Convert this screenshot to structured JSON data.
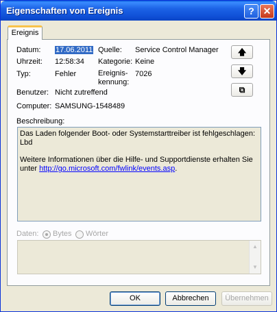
{
  "window": {
    "title": "Eigenschaften von Ereignis",
    "help_glyph": "?",
    "close_glyph": "✕"
  },
  "tab": {
    "label": "Ereignis"
  },
  "fields": {
    "datum_label": "Datum:",
    "datum_value": "17.06.2011",
    "uhrzeit_label": "Uhrzeit:",
    "uhrzeit_value": "12:58:34",
    "typ_label": "Typ:",
    "typ_value": "Fehler",
    "benutzer_label": "Benutzer:",
    "benutzer_value": "Nicht zutreffend",
    "computer_label": "Computer:",
    "computer_value": "SAMSUNG-1548489",
    "quelle_label": "Quelle:",
    "quelle_value": "Service Control Manager",
    "kategorie_label": "Kategorie:",
    "kategorie_value": "Keine",
    "kennung_label": "Ereignis-kennung:",
    "kennung_value": "7026"
  },
  "side_buttons": {
    "up_icon": "up-arrow-icon",
    "up_glyph": "🡅",
    "down_icon": "down-arrow-icon",
    "down_glyph": "🡇",
    "copy_icon": "copy-icon",
    "copy_glyph": "⧉"
  },
  "description": {
    "label": "Beschreibung:",
    "line1": "Das Laden folgender Boot- oder Systemstarttreiber ist fehlgeschlagen:",
    "line2": "Lbd",
    "line3": "Weitere Informationen über die Hilfe- und Supportdienste erhalten Sie",
    "line4_prefix": "unter ",
    "link": "http://go.microsoft.com/fwlink/events.asp",
    "line4_suffix": "."
  },
  "daten": {
    "label": "Daten:",
    "opt_bytes": "Bytes",
    "opt_woerter": "Wörter",
    "selected": "Bytes"
  },
  "buttons": {
    "ok": "OK",
    "cancel": "Abbrechen",
    "apply": "Übernehmen"
  }
}
